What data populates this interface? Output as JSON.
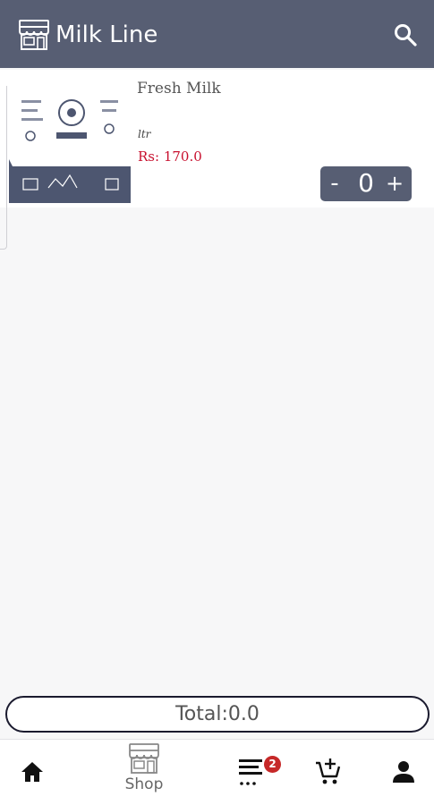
{
  "header": {
    "title": "Milk Line",
    "logo_icon": "store-icon",
    "search_icon": "search-icon",
    "bar_color": "#575e73"
  },
  "product": {
    "name": "Fresh Milk",
    "unit": "ltr",
    "price": "Rs: 170.0",
    "price_color": "#c8102e",
    "quantity": "0",
    "minus_label": "-",
    "plus_label": "+"
  },
  "footer": {
    "total": "Total:0.0"
  },
  "bottom_nav": {
    "home_icon": "home-icon",
    "shop_label": "Shop",
    "orders_badge": "2",
    "cart_icon": "add-to-cart-icon",
    "profile_icon": "person-icon"
  }
}
